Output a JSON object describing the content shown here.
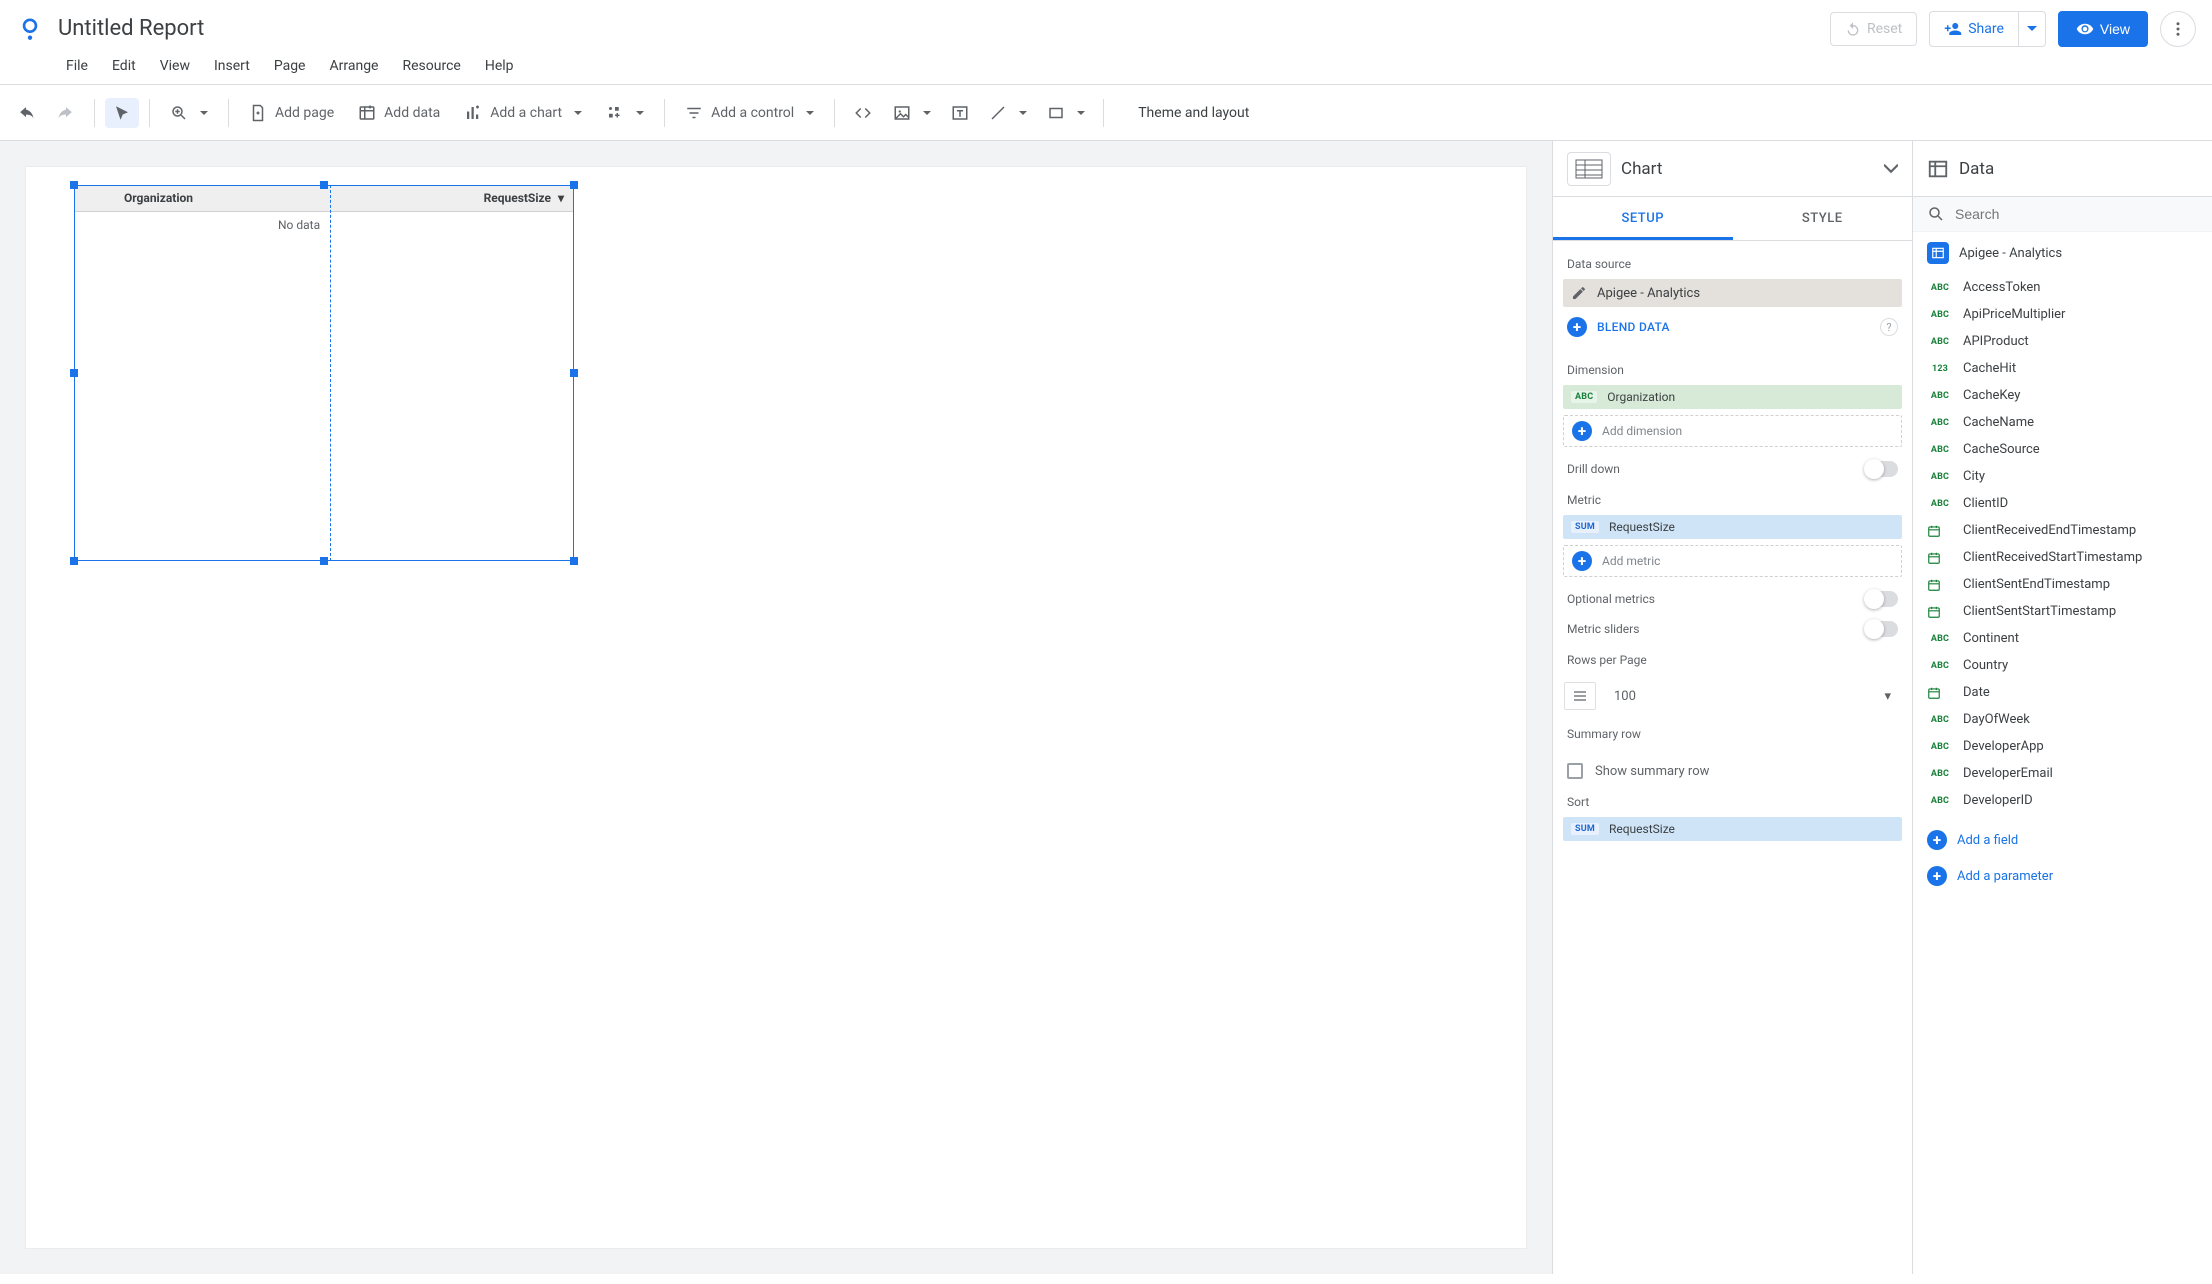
{
  "header": {
    "doc_title": "Untitled Report",
    "reset_label": "Reset",
    "share_label": "Share",
    "view_label": "View"
  },
  "menubar": {
    "items": [
      "File",
      "Edit",
      "View",
      "Insert",
      "Page",
      "Arrange",
      "Resource",
      "Help"
    ]
  },
  "toolbar": {
    "add_page": "Add page",
    "add_data": "Add data",
    "add_chart": "Add a chart",
    "add_control": "Add a control",
    "theme_layout": "Theme and layout"
  },
  "canvas": {
    "table": {
      "columns": [
        "Organization",
        "RequestSize"
      ],
      "no_data": "No data"
    }
  },
  "chart_panel": {
    "title": "Chart",
    "tabs": {
      "setup": "SETUP",
      "style": "STYLE"
    },
    "sections": {
      "data_source": "Data source",
      "dimension": "Dimension",
      "drill_down": "Drill down",
      "metric": "Metric",
      "optional_metrics": "Optional metrics",
      "metric_sliders": "Metric sliders",
      "rows_per_page": "Rows per Page",
      "summary_row": "Summary row",
      "sort": "Sort"
    },
    "data_source_name": "Apigee - Analytics",
    "blend_data": "BLEND DATA",
    "dimension_chip": {
      "type": "ABC",
      "name": "Organization"
    },
    "add_dimension": "Add dimension",
    "metric_chip": {
      "type": "SUM",
      "name": "RequestSize"
    },
    "add_metric": "Add metric",
    "rows_per_page_value": "100",
    "show_summary_row": "Show summary row",
    "sort_chip": {
      "type": "SUM",
      "name": "RequestSize"
    }
  },
  "data_panel": {
    "title": "Data",
    "search_placeholder": "Search",
    "data_source_name": "Apigee - Analytics",
    "fields": [
      {
        "type": "abc",
        "name": "AccessToken"
      },
      {
        "type": "abc",
        "name": "ApiPriceMultiplier"
      },
      {
        "type": "abc",
        "name": "APIProduct"
      },
      {
        "type": "num",
        "name": "CacheHit"
      },
      {
        "type": "abc",
        "name": "CacheKey"
      },
      {
        "type": "abc",
        "name": "CacheName"
      },
      {
        "type": "abc",
        "name": "CacheSource"
      },
      {
        "type": "abc",
        "name": "City"
      },
      {
        "type": "abc",
        "name": "ClientID"
      },
      {
        "type": "date",
        "name": "ClientReceivedEndTimestamp"
      },
      {
        "type": "date",
        "name": "ClientReceivedStartTimestamp"
      },
      {
        "type": "date",
        "name": "ClientSentEndTimestamp"
      },
      {
        "type": "date",
        "name": "ClientSentStartTimestamp"
      },
      {
        "type": "abc",
        "name": "Continent"
      },
      {
        "type": "abc",
        "name": "Country"
      },
      {
        "type": "date",
        "name": "Date"
      },
      {
        "type": "abc",
        "name": "DayOfWeek"
      },
      {
        "type": "abc",
        "name": "DeveloperApp"
      },
      {
        "type": "abc",
        "name": "DeveloperEmail"
      },
      {
        "type": "abc",
        "name": "DeveloperID"
      }
    ],
    "add_field": "Add a field",
    "add_parameter": "Add a parameter"
  }
}
